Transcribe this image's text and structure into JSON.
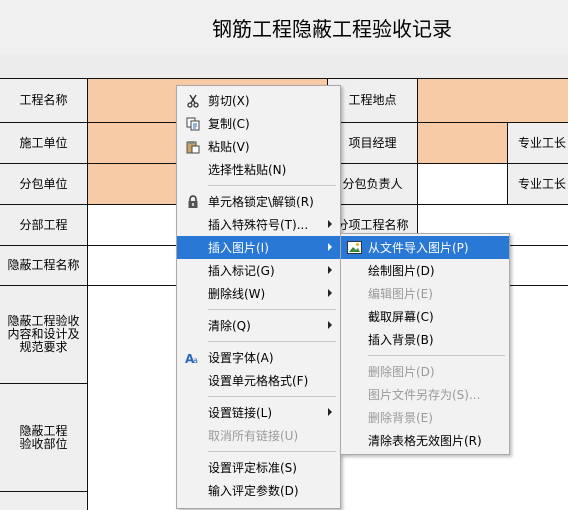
{
  "doc_title": "钢筋工程隐蔽工程验收记录",
  "labels": {
    "project_name": "工程名称",
    "contractor": "施工单位",
    "subcontractor": "分包单位",
    "sub_project": "分部工程",
    "concealed_name": "隐蔽工程名称",
    "content": "隐蔽工程验收内容和设计及规范要求",
    "location": "隐蔽工程验收部位",
    "project_location": "工程地点",
    "project_manager": "项目经理",
    "sub_manager": "分包负责人",
    "sub_item_name": "分项工程名称",
    "foreman": "专业工长"
  },
  "context_menu": {
    "items": [
      {
        "label": "剪切(X)",
        "icon": "scissors-icon"
      },
      {
        "label": "复制(C)",
        "icon": "copy-icon"
      },
      {
        "label": "粘贴(V)",
        "icon": "paste-icon"
      },
      {
        "label": "选择性粘贴(N)"
      },
      {
        "label": "单元格锁定\\解锁(R)",
        "icon": "lock-icon"
      },
      {
        "label": "插入特殊符号(T)...",
        "submenu": true
      },
      {
        "label": "插入图片(I)",
        "submenu": true,
        "highlighted": true
      },
      {
        "label": "插入标记(G)",
        "submenu": true
      },
      {
        "label": "删除线(W)",
        "submenu": true
      },
      {
        "label": "清除(Q)",
        "submenu": true
      },
      {
        "label": "设置字体(A)",
        "icon": "font-icon"
      },
      {
        "label": "设置单元格格式(F)"
      },
      {
        "label": "设置链接(L)",
        "submenu": true
      },
      {
        "label": "取消所有链接(U)",
        "disabled": true
      },
      {
        "label": "设置评定标准(S)"
      },
      {
        "label": "输入评定参数(D)"
      }
    ]
  },
  "picture_submenu": {
    "items": [
      {
        "label": "从文件导入图片(P)",
        "icon": "image-icon",
        "highlighted": true
      },
      {
        "label": "绘制图片(D)"
      },
      {
        "label": "编辑图片(E)",
        "disabled": true
      },
      {
        "label": "截取屏幕(C)"
      },
      {
        "label": "插入背景(B)"
      },
      {
        "label": "删除图片(D)",
        "disabled": true
      },
      {
        "label": "图片文件另存为(S)...",
        "disabled": true
      },
      {
        "label": "删除背景(E)",
        "disabled": true
      },
      {
        "label": "清除表格无效图片(R)"
      }
    ]
  },
  "colors": {
    "highlight": "#2a78d6",
    "peach_cell": "#f7cba6",
    "label_cell": "#efefef"
  }
}
